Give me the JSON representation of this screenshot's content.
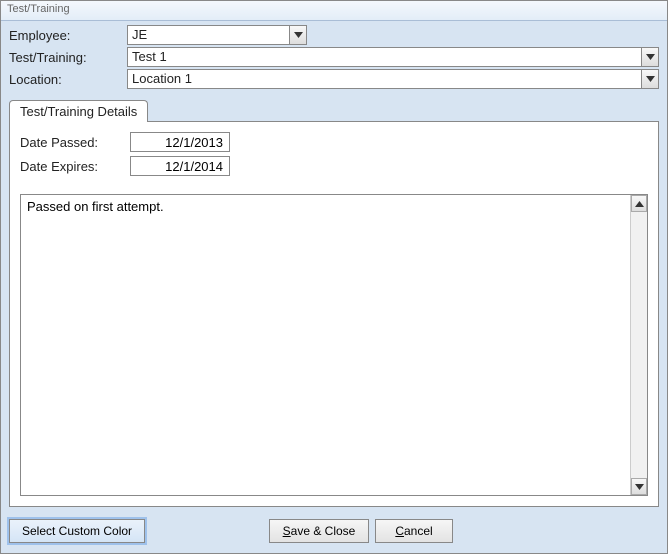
{
  "window": {
    "title": "Test/Training"
  },
  "header": {
    "employee_label": "Employee:",
    "employee_value": "JE",
    "testtraining_label": "Test/Training:",
    "testtraining_value": "Test 1",
    "location_label": "Location:",
    "location_value": "Location 1"
  },
  "tab": {
    "label": "Test/Training Details"
  },
  "details": {
    "date_passed_label": "Date Passed:",
    "date_passed_value": "12/1/2013",
    "date_expires_label": "Date Expires:",
    "date_expires_value": "12/1/2014",
    "notes": "Passed on first attempt."
  },
  "footer": {
    "custom_color": "Select Custom Color",
    "save_close": "Save & Close",
    "cancel": "Cancel"
  }
}
